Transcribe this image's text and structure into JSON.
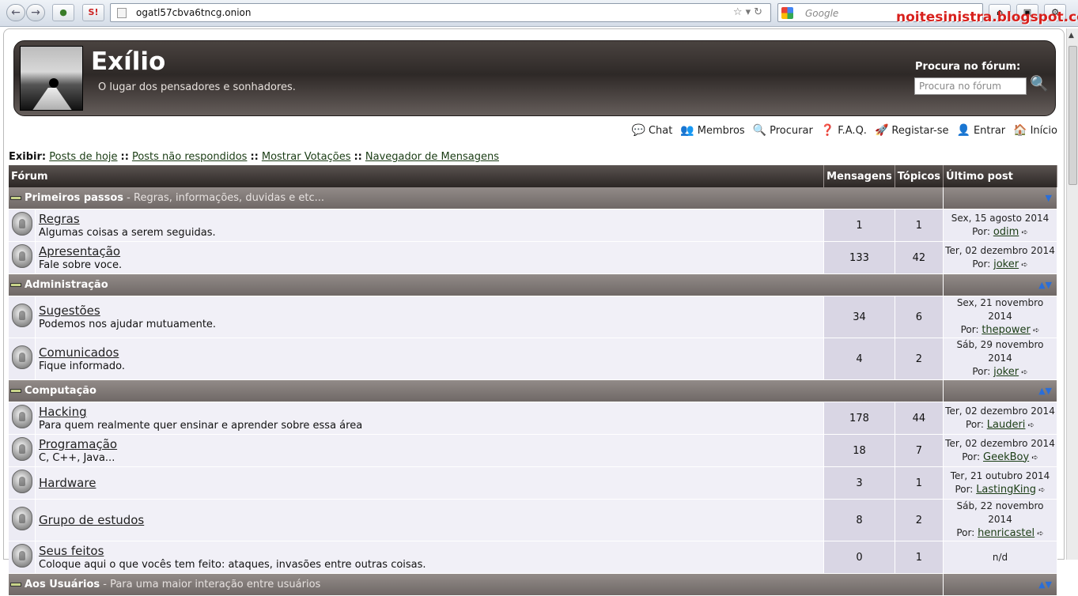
{
  "browser": {
    "url": "ogatl57cbva6tncg.onion",
    "search_engine": "Google",
    "search_placeholder": "Google",
    "watermark": "noitesinistra.blogspot.com.br",
    "icons": [
      "back-icon",
      "forward-icon",
      "onion-icon",
      "noscript-icon",
      "page-icon",
      "bookmark-star-icon",
      "refresh-icon",
      "home-icon"
    ]
  },
  "header": {
    "title": "Exílio",
    "subtitle": "O lugar dos pensadores e sonhadores.",
    "search_label": "Procura no fórum:",
    "search_placeholder": "Procura no fórum"
  },
  "topnav": [
    {
      "label": "Chat",
      "icon": "chat-icon"
    },
    {
      "label": "Membros",
      "icon": "members-icon"
    },
    {
      "label": "Procurar",
      "icon": "search-icon"
    },
    {
      "label": "F.A.Q.",
      "icon": "faq-icon"
    },
    {
      "label": "Registar-se",
      "icon": "register-icon"
    },
    {
      "label": "Entrar",
      "icon": "login-icon"
    },
    {
      "label": "Início",
      "icon": "home-icon"
    }
  ],
  "exibir": {
    "label": "Exibir:",
    "links": [
      "Posts de hoje",
      "Posts não respondidos",
      "Mostrar Votações",
      "Navegador de Mensagens"
    ]
  },
  "table": {
    "headers": {
      "forum": "Fórum",
      "messages": "Mensagens",
      "topics": "Tópicos",
      "last": "Último post"
    },
    "by_label": "Por:"
  },
  "categories": [
    {
      "name": "Primeiros passos",
      "desc": " - Regras, informações, duvidas e etc...",
      "arrows": "▼",
      "forums": [
        {
          "name": "Regras",
          "desc": "Algumas coisas a serem seguidas.",
          "messages": "1",
          "topics": "1",
          "date": "Sex, 15 agosto 2014",
          "user": "odim"
        },
        {
          "name": "Apresentação",
          "desc": "Fale sobre voce.",
          "messages": "133",
          "topics": "42",
          "date": "Ter, 02 dezembro 2014",
          "user": "joker"
        }
      ]
    },
    {
      "name": "Administração",
      "desc": "",
      "arrows": "▲▼",
      "forums": [
        {
          "name": "Sugestões",
          "desc": "Podemos nos ajudar mutuamente.",
          "messages": "34",
          "topics": "6",
          "date": "Sex, 21 novembro 2014",
          "user": "thepower"
        },
        {
          "name": "Comunicados",
          "desc": "Fique informado.",
          "messages": "4",
          "topics": "2",
          "date": "Sáb, 29 novembro 2014",
          "user": "joker"
        }
      ]
    },
    {
      "name": "Computação",
      "desc": "",
      "arrows": "▲▼",
      "forums": [
        {
          "name": "Hacking",
          "desc": "Para quem realmente quer ensinar e aprender sobre essa área",
          "messages": "178",
          "topics": "44",
          "date": "Ter, 02 dezembro 2014",
          "user": "Lauderi"
        },
        {
          "name": "Programação",
          "desc": "C, C++, Java...",
          "messages": "18",
          "topics": "7",
          "date": "Ter, 02 dezembro 2014",
          "user": "GeekBoy"
        },
        {
          "name": "Hardware",
          "desc": "",
          "messages": "3",
          "topics": "1",
          "date": "Ter, 21 outubro 2014",
          "user": "LastingKing"
        },
        {
          "name": "Grupo de estudos",
          "desc": "",
          "messages": "8",
          "topics": "2",
          "date": "Sáb, 22 novembro 2014",
          "user": "henricastel"
        },
        {
          "name": "Seus feitos",
          "desc": "Coloque aqui o que vocês tem feito: ataques, invasões entre outras coisas.",
          "messages": "0",
          "topics": "1",
          "date": "",
          "user": "",
          "none": "n/d"
        }
      ]
    },
    {
      "name": "Aos Usuários",
      "desc": " - Para uma maior interação entre usuários",
      "arrows": "▲▼",
      "forums": []
    }
  ]
}
